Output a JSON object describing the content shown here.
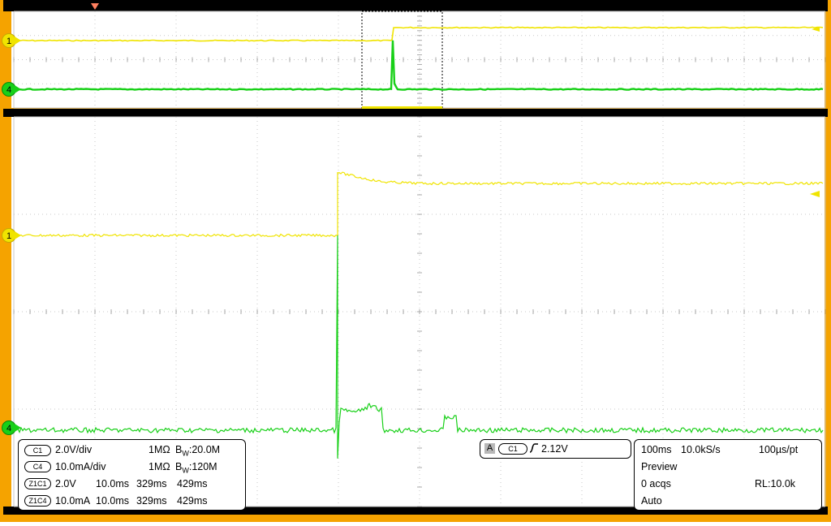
{
  "colors": {
    "frame": "#f5a300",
    "ch1": "#f0e400",
    "ch4": "#18d018",
    "grid": "#c8c8c8",
    "zoom_box": "#000000"
  },
  "zoom_overview": {
    "ch1_marker": "1",
    "ch4_marker": "4"
  },
  "main_view": {
    "ch1_marker": "1",
    "ch4_marker": "4"
  },
  "channels": [
    {
      "badge": "C1",
      "scale": "2.0V/div",
      "impedance": "1MΩ",
      "bw_prefix": "B",
      "bw_sub": "W",
      "bandwidth": ":20.0M"
    },
    {
      "badge": "C4",
      "scale": "10.0mA/div",
      "impedance": "1MΩ",
      "bw_prefix": "B",
      "bw_sub": "W",
      "bandwidth": ":120M"
    }
  ],
  "zoom_rows": [
    {
      "badge": "Z1C1",
      "scale": "2.0V",
      "time": "10.0ms",
      "start": "329ms",
      "end": "429ms"
    },
    {
      "badge": "Z1C4",
      "scale": "10.0mA",
      "time": "10.0ms",
      "start": "329ms",
      "end": "429ms"
    }
  ],
  "trigger": {
    "mode_badge": "A",
    "source_badge": "C1",
    "slope_icon": "rising-edge-icon",
    "level": "2.12V"
  },
  "timebase": {
    "time_per_div": "100ms",
    "sample_rate": "10.0kS/s",
    "resolution": "100µs/pt",
    "mode": "Preview",
    "acquisitions": "0 acqs",
    "record_length": "RL:10.0k",
    "trigger_mode": "Auto"
  }
}
